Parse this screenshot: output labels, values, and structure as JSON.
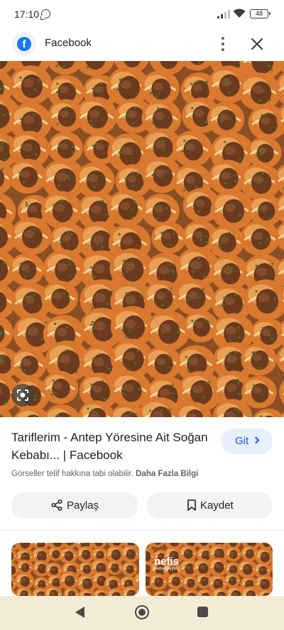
{
  "status_bar": {
    "time": "17:10",
    "battery": "48"
  },
  "header": {
    "source_name": "Facebook",
    "logo_letter": "f",
    "icons": [
      "facebook-logo-icon",
      "more-vert-icon",
      "close-icon"
    ]
  },
  "image": {
    "subject": "oven tray of onion kebab (onion halves stuffed with meatballs)"
  },
  "result": {
    "title": "Tariflerim - Antep Yöresine Ait Soğan Kebabı... | Facebook",
    "visit_label": "Git",
    "copyright_text": "Görseller telif hakkına tabi olabilir.",
    "more_info_link": "Daha Fazla Bilgi"
  },
  "actions": {
    "share_label": "Paylaş",
    "save_label": "Kaydet"
  },
  "related": {
    "thumb2_brand": "nefis",
    "thumb2_sub": "yemektarifleri"
  },
  "colors": {
    "accent_blue": "#1a56d6",
    "chip_bg": "#f1f3f4",
    "visit_bg": "#e8f0fe",
    "facebook_blue": "#1877f2",
    "nav_bg": "#f4ecd6"
  }
}
